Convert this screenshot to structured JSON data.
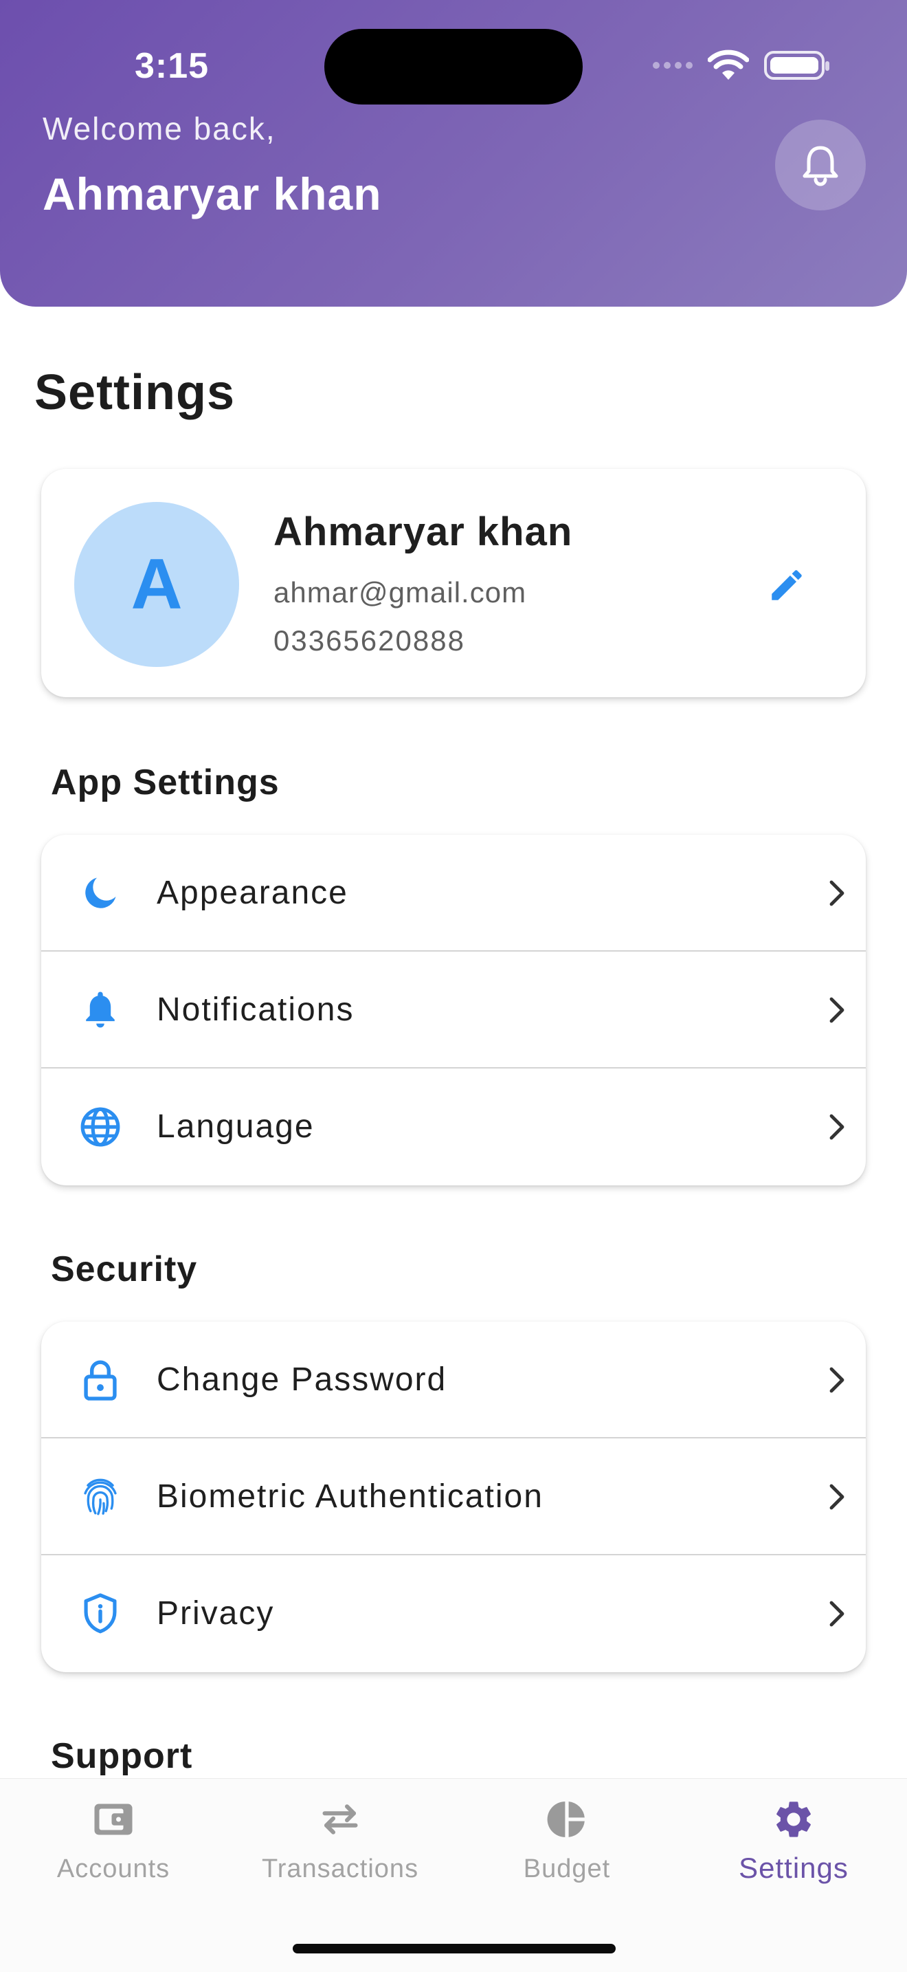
{
  "status_bar": {
    "time": "3:15"
  },
  "header": {
    "welcome": "Welcome back,",
    "user_name": "Ahmaryar khan",
    "notification_icon": "bell-icon"
  },
  "page": {
    "title": "Settings"
  },
  "profile": {
    "avatar_letter": "A",
    "name": "Ahmaryar khan",
    "email": "ahmar@gmail.com",
    "phone": "03365620888",
    "edit_icon": "pencil-icon"
  },
  "sections": {
    "app_settings": {
      "title": "App Settings",
      "items": [
        {
          "label": "Appearance",
          "icon": "moon-icon"
        },
        {
          "label": "Notifications",
          "icon": "bell-icon"
        },
        {
          "label": "Language",
          "icon": "globe-icon"
        }
      ]
    },
    "security": {
      "title": "Security",
      "items": [
        {
          "label": "Change Password",
          "icon": "lock-icon"
        },
        {
          "label": "Biometric Authentication",
          "icon": "fingerprint-icon"
        },
        {
          "label": "Privacy",
          "icon": "shield-icon"
        }
      ]
    },
    "support": {
      "title": "Support"
    }
  },
  "bottom_nav": {
    "items": [
      {
        "label": "Accounts",
        "icon": "wallet-icon",
        "active": false
      },
      {
        "label": "Transactions",
        "icon": "swap-arrows-icon",
        "active": false
      },
      {
        "label": "Budget",
        "icon": "pie-chart-icon",
        "active": false
      },
      {
        "label": "Settings",
        "icon": "gear-icon",
        "active": true
      }
    ]
  },
  "colors": {
    "header_gradient_start": "#6d4fae",
    "header_gradient_end": "#8c7cbd",
    "icon_accent": "#2b8ef0",
    "nav_active": "#6b53a8",
    "nav_inactive": "#a3a3a3"
  }
}
